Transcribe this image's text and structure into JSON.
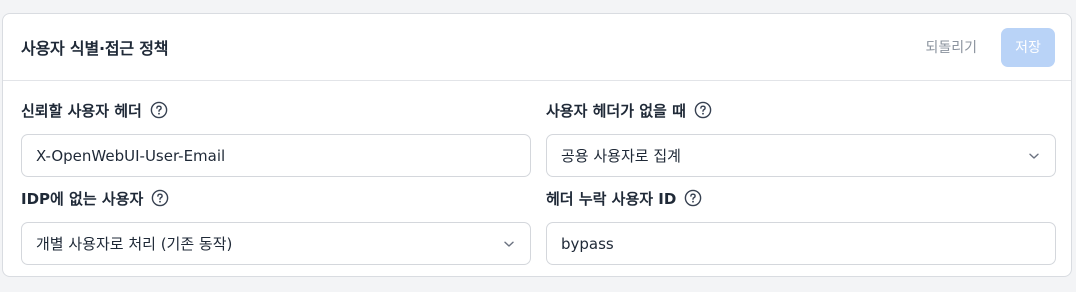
{
  "panel": {
    "title": "사용자 식별·접근 정책",
    "revert_label": "되돌리기",
    "save_label": "저장"
  },
  "fields": {
    "trusted_header": {
      "label": "신뢰할 사용자 헤더",
      "value": "X-OpenWebUI-User-Email"
    },
    "missing_header_action": {
      "label": "사용자 헤더가 없을 때",
      "selected": "공용 사용자로 집계"
    },
    "not_in_idp": {
      "label": "IDP에 없는 사용자",
      "selected": "개별 사용자로 처리 (기존 동작)"
    },
    "missing_header_user_id": {
      "label": "헤더 누락 사용자 ID",
      "value": "bypass"
    }
  },
  "icons": {
    "help": "help-circle-icon",
    "chevron": "chevron-down-icon"
  },
  "colors": {
    "save_button_disabled": "#b9d3f7",
    "revert_text": "#8b939e",
    "border": "#d4d7dc"
  }
}
